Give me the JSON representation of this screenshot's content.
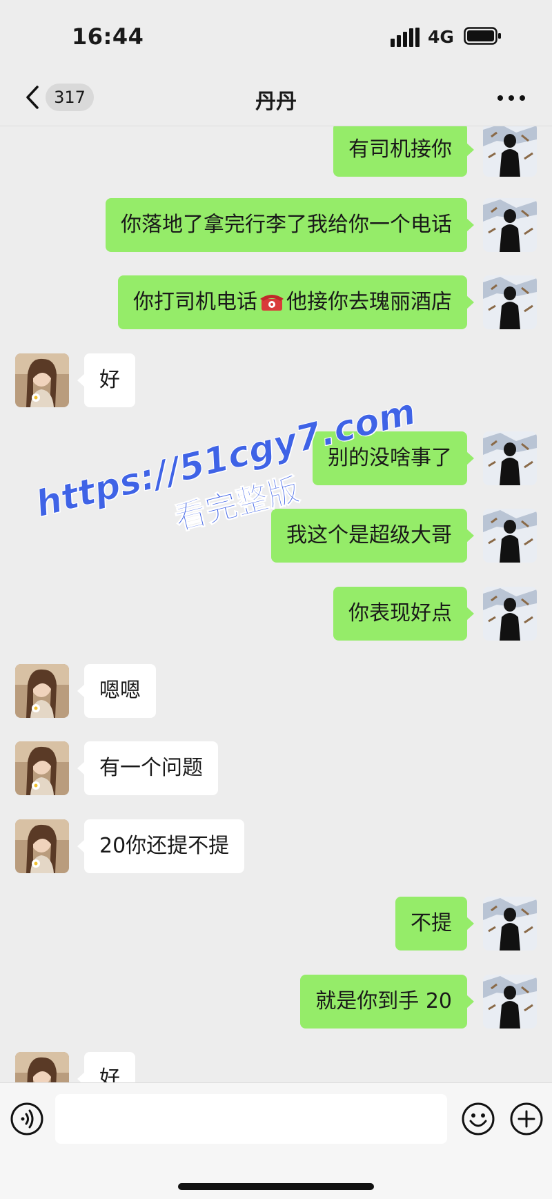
{
  "status_bar": {
    "time": "16:44",
    "network": "4G",
    "signal_icon": "signal-bars-icon",
    "battery_icon": "battery-icon"
  },
  "header": {
    "back_icon": "chevron-left-icon",
    "unread_count": "317",
    "title": "丹丹",
    "more_icon": "more-dots-icon"
  },
  "messages": [
    {
      "side": "me",
      "text": "有司机接你"
    },
    {
      "side": "me",
      "text": "你落地了拿完行李了我给你一个电话"
    },
    {
      "side": "me",
      "text_before": "你打司机电话",
      "emoji": "telephone-emoji",
      "text_after": "他接你去瑰丽酒店"
    },
    {
      "side": "them",
      "text": "好"
    },
    {
      "side": "me",
      "text": "别的没啥事了"
    },
    {
      "side": "me",
      "text": "我这个是超级大哥"
    },
    {
      "side": "me",
      "text": "你表现好点"
    },
    {
      "side": "them",
      "text": "嗯嗯"
    },
    {
      "side": "them",
      "text": "有一个问题"
    },
    {
      "side": "them",
      "text": "20你还提不提"
    },
    {
      "side": "me",
      "text": "不提"
    },
    {
      "side": "me",
      "text": "就是你到手 20"
    },
    {
      "side": "them",
      "text": "好"
    }
  ],
  "watermark": {
    "url": "https://51cgy7.com",
    "subtitle": "看完整版"
  },
  "input_bar": {
    "voice_icon": "voice-icon",
    "message_value": "",
    "emoji_icon": "emoji-icon",
    "plus_icon": "plus-icon"
  },
  "colors": {
    "background": "#ededed",
    "my_bubble": "#95ec69",
    "their_bubble": "#ffffff",
    "watermark": "#3f63e6"
  }
}
